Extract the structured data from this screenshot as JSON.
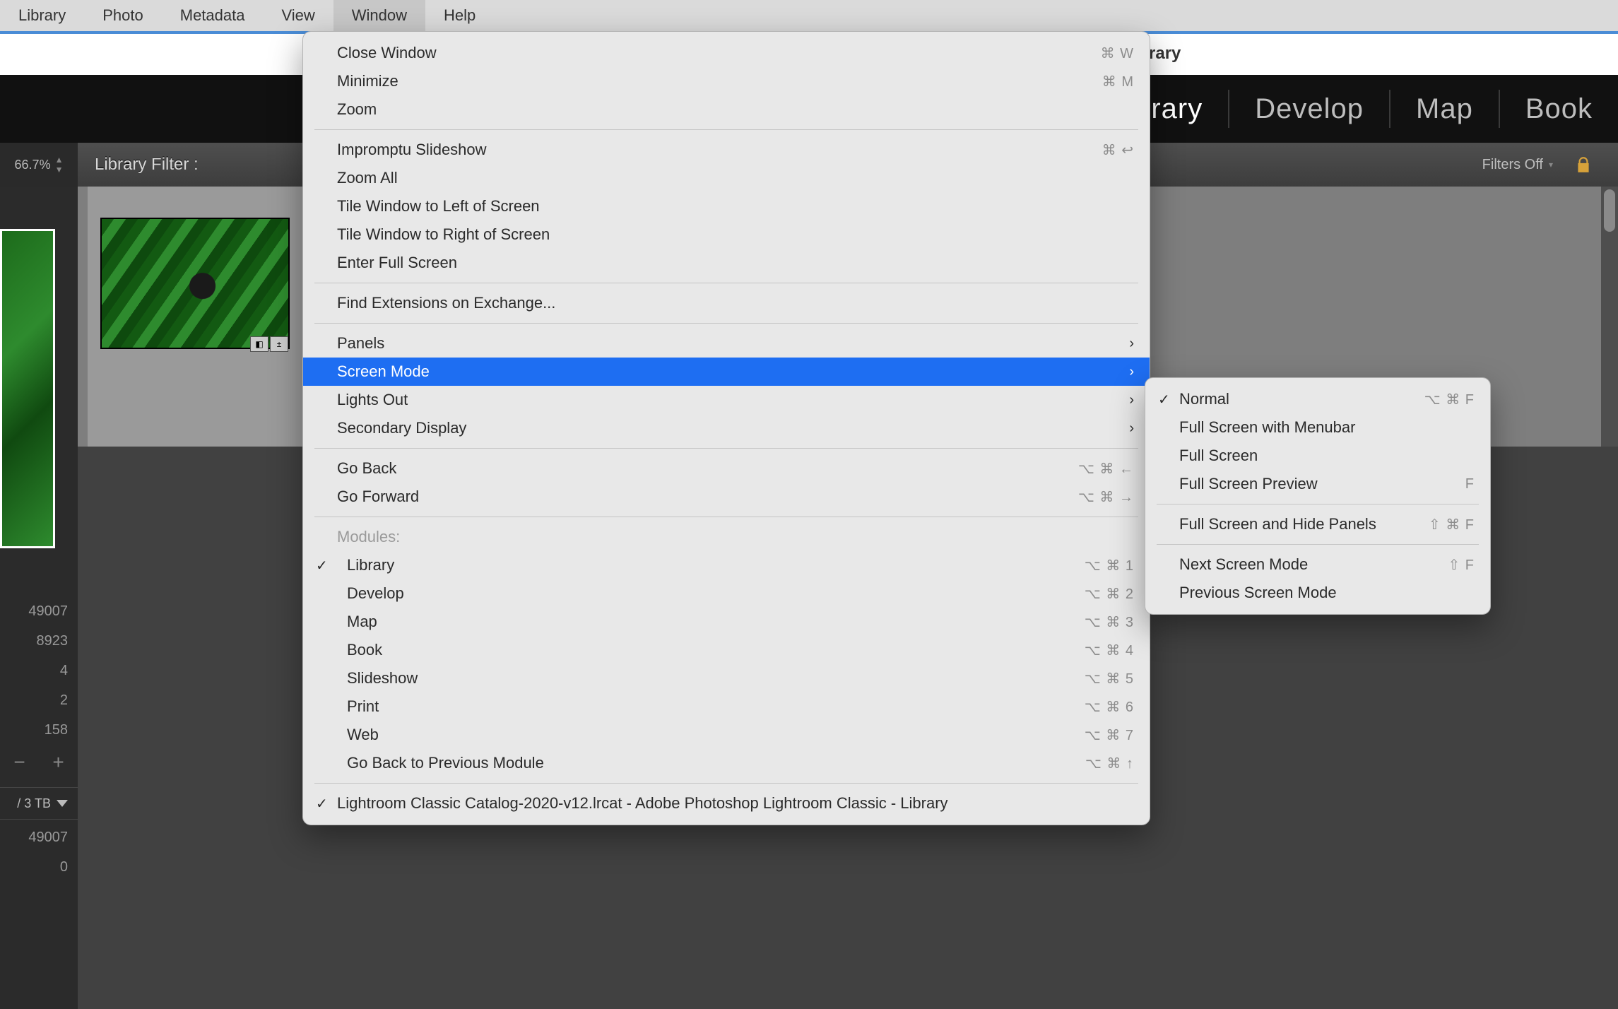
{
  "menubar": {
    "items": [
      "Library",
      "Photo",
      "Metadata",
      "View",
      "Window",
      "Help"
    ],
    "active_index": 4
  },
  "white_tab": {
    "label": "rary"
  },
  "module_tabs": [
    "brary",
    "Develop",
    "Map",
    "Book"
  ],
  "module_active_index": 0,
  "filterbar": {
    "zoom": "66.7%",
    "label": "Library Filter :",
    "filters_off": "Filters Off"
  },
  "left_counts_top": [
    "49007",
    "8923",
    "4",
    "2",
    "158"
  ],
  "left_pm": {
    "minus": "−",
    "plus": "+"
  },
  "left_storage": "/ 3 TB",
  "left_counts_bottom": [
    "49007",
    "0"
  ],
  "window_menu": {
    "groups": [
      {
        "items": [
          {
            "label": "Close Window",
            "shortcut": "⌘ W"
          },
          {
            "label": "Minimize",
            "shortcut": "⌘ M"
          },
          {
            "label": "Zoom"
          }
        ]
      },
      {
        "items": [
          {
            "label": "Impromptu Slideshow",
            "shortcut": "⌘ ↩"
          },
          {
            "label": "Zoom All"
          },
          {
            "label": "Tile Window to Left of Screen"
          },
          {
            "label": "Tile Window to Right of Screen"
          },
          {
            "label": "Enter Full Screen"
          }
        ]
      },
      {
        "items": [
          {
            "label": "Find Extensions on Exchange..."
          }
        ]
      },
      {
        "items": [
          {
            "label": "Panels",
            "submenu": true
          },
          {
            "label": "Screen Mode",
            "submenu": true,
            "highlight": true
          },
          {
            "label": "Lights Out",
            "submenu": true
          },
          {
            "label": "Secondary Display",
            "submenu": true
          }
        ]
      },
      {
        "items": [
          {
            "label": "Go Back",
            "shortcut": "⌥ ⌘ ←"
          },
          {
            "label": "Go Forward",
            "shortcut": "⌥ ⌘ →"
          }
        ]
      },
      {
        "heading": "Modules:",
        "items": [
          {
            "label": "Library",
            "shortcut": "⌥ ⌘ 1",
            "checked": true
          },
          {
            "label": "Develop",
            "shortcut": "⌥ ⌘ 2"
          },
          {
            "label": "Map",
            "shortcut": "⌥ ⌘ 3"
          },
          {
            "label": "Book",
            "shortcut": "⌥ ⌘ 4"
          },
          {
            "label": "Slideshow",
            "shortcut": "⌥ ⌘ 5"
          },
          {
            "label": "Print",
            "shortcut": "⌥ ⌘ 6"
          },
          {
            "label": "Web",
            "shortcut": "⌥ ⌘ 7"
          },
          {
            "label": "Go Back to Previous Module",
            "shortcut": "⌥ ⌘ ↑"
          }
        ]
      },
      {
        "items": [
          {
            "label": "Lightroom Classic Catalog-2020-v12.lrcat - Adobe Photoshop Lightroom Classic - Library",
            "checked": true
          }
        ]
      }
    ]
  },
  "screen_mode_submenu": {
    "items": [
      {
        "label": "Normal",
        "checked": true,
        "shortcut": "⌥ ⌘ F"
      },
      {
        "label": "Full Screen with Menubar"
      },
      {
        "label": "Full Screen"
      },
      {
        "label": "Full Screen Preview",
        "shortcut": "F"
      },
      {
        "sep": true
      },
      {
        "label": "Full Screen and Hide Panels",
        "shortcut": "⇧ ⌘ F"
      },
      {
        "sep": true
      },
      {
        "label": "Next Screen Mode",
        "shortcut": "⇧ F"
      },
      {
        "label": "Previous Screen Mode"
      }
    ]
  }
}
